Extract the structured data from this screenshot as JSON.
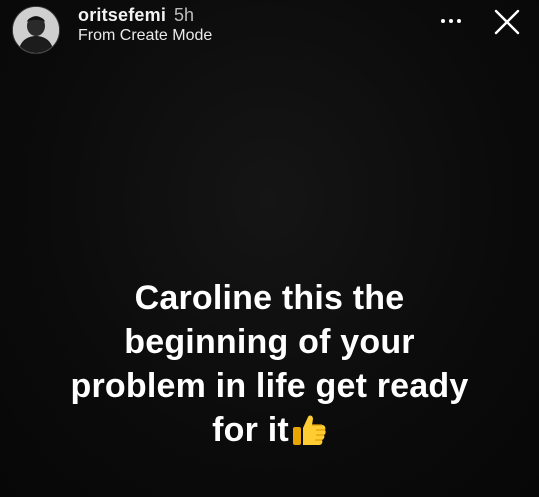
{
  "header": {
    "username": "oritsefemi",
    "timestamp": "5h",
    "subtitle": "From Create Mode",
    "avatar_icon": "profile-photo",
    "more_icon": "more-horizontal-icon",
    "close_icon": "close-icon"
  },
  "story": {
    "text_lines": [
      "Caroline this the",
      "beginning of your",
      "problem in life get ready",
      "for it"
    ],
    "emoji": "thumbs-up",
    "background_color": "#0b0b0b",
    "text_color": "#ffffff"
  }
}
